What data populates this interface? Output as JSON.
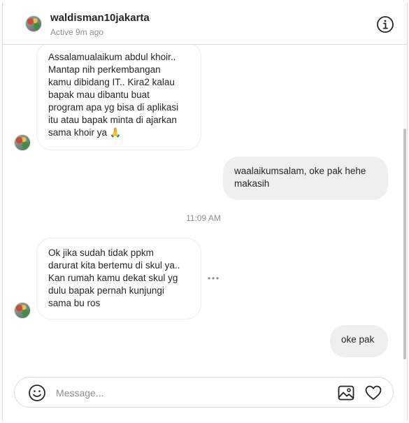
{
  "header": {
    "username": "waldisman10jakarta",
    "status": "Active 9m ago",
    "avatar_icon": "profile-avatar",
    "info_icon": "info-icon"
  },
  "messages": [
    {
      "direction": "incoming",
      "text": "Assalamualaikum abdul khoir..\nMantap nih perkembangan\nkamu dibidang IT.. Kira2 kalau\nbapak mau dibantu buat\nprogram apa yg bisa di aplikasi\nitu atau bapak minta di ajarkan\nsama khoir ya 🙏"
    },
    {
      "direction": "outgoing",
      "text": "waalaikumsalam, oke pak hehe\nmakasih"
    },
    {
      "direction": "incoming",
      "text": "Ok jika sudah tidak ppkm\ndarurat kita bertemu di skul ya..\nKan rumah kamu dekat skul yg\ndulu bapak pernah kunjungi\nsama bu ros"
    },
    {
      "direction": "outgoing",
      "text": "oke pak"
    }
  ],
  "timestamp": "11:09 AM",
  "composer": {
    "placeholder": "Message...",
    "value": "",
    "emoji_icon": "emoji-icon",
    "image_icon": "image-icon",
    "like_icon": "heart-icon"
  }
}
